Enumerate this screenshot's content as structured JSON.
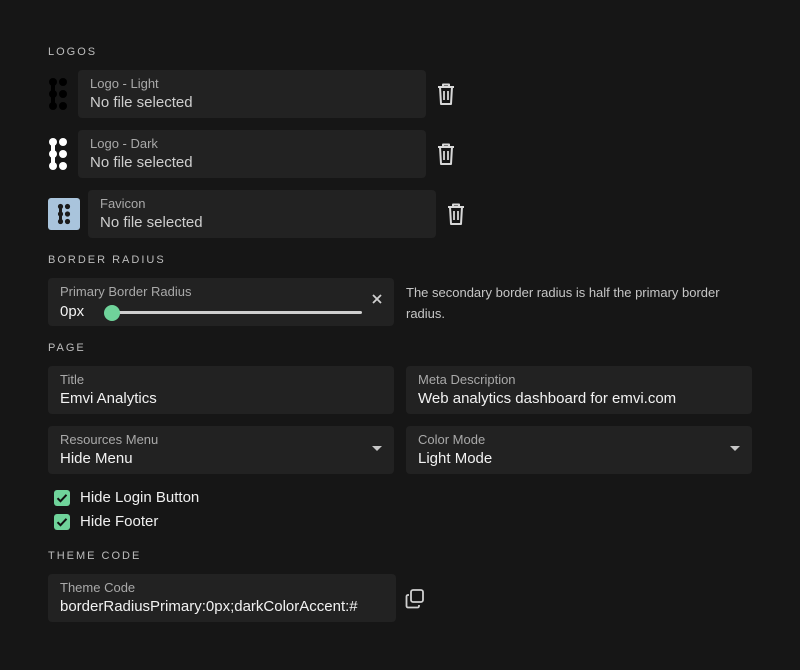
{
  "sections": {
    "logos": "LOGOS",
    "border_radius": "BORDER RADIUS",
    "page": "PAGE",
    "theme_code": "THEME CODE"
  },
  "logos": [
    {
      "label": "Logo - Light",
      "value": "No file selected",
      "thumb_color": "#000000"
    },
    {
      "label": "Logo - Dark",
      "value": "No file selected",
      "thumb_color": "#ffffff"
    },
    {
      "label": "Favicon",
      "value": "No file selected",
      "thumb_color": "#a9c4dc"
    }
  ],
  "border_radius": {
    "label": "Primary Border Radius",
    "value": "0px",
    "slider_level": 0,
    "helper": "The secondary border radius is half the primary border radius."
  },
  "page": {
    "title": {
      "label": "Title",
      "value": "Emvi Analytics"
    },
    "meta": {
      "label": "Meta Description",
      "value": "Web analytics dashboard for emvi.com"
    },
    "resources": {
      "label": "Resources Menu",
      "value": "Hide Menu"
    },
    "color_mode": {
      "label": "Color Mode",
      "value": "Light Mode"
    },
    "checkboxes": [
      {
        "label": "Hide Login Button",
        "checked": true
      },
      {
        "label": "Hide Footer",
        "checked": true
      }
    ]
  },
  "theme": {
    "label": "Theme Code",
    "value": "borderRadiusPrimary:0px;darkColorAccent:#"
  },
  "colors": {
    "background": "#161616",
    "field": "#222222",
    "accent": "#6fd39a"
  }
}
